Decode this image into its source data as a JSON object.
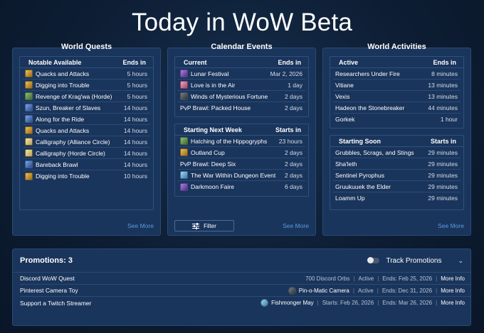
{
  "page_title": "Today in WoW Beta",
  "world_quests": {
    "title": "World Quests",
    "header_name": "Notable Available",
    "header_time": "Ends in",
    "items": [
      {
        "name": "Quacks and Attacks",
        "time": "5 hours",
        "icon": "gold"
      },
      {
        "name": "Digging into Trouble",
        "time": "5 hours",
        "icon": "gold"
      },
      {
        "name": "Revenge of Krag'wa (Horde)",
        "time": "5 hours",
        "icon": "green"
      },
      {
        "name": "Szun, Breaker of Slaves",
        "time": "14 hours",
        "icon": "blue"
      },
      {
        "name": "Along for the Ride",
        "time": "14 hours",
        "icon": "blue"
      },
      {
        "name": "Quacks and Attacks",
        "time": "14 hours",
        "icon": "gold"
      },
      {
        "name": "Calligraphy (Alliance Circle)",
        "time": "14 hours",
        "icon": "parch"
      },
      {
        "name": "Calligraphy (Horde Circle)",
        "time": "14 hours",
        "icon": "parch"
      },
      {
        "name": "Bareback Brawl",
        "time": "14 hours",
        "icon": "blue"
      },
      {
        "name": "Digging into Trouble",
        "time": "10 hours",
        "icon": "gold"
      }
    ],
    "see_more": "See More"
  },
  "calendar": {
    "title": "Calendar Events",
    "current_header": "Current",
    "current_time_header": "Ends in",
    "current": [
      {
        "name": "Lunar Festival",
        "time": "Mar 2, 2026",
        "icon": "purple"
      },
      {
        "name": "Love is in the Air",
        "time": "1 day",
        "icon": "pink"
      },
      {
        "name": "Winds of Mysterious Fortune",
        "time": "2 days",
        "icon": "dark"
      },
      {
        "name": "PvP Brawl: Packed House",
        "time": "2 days",
        "icon": ""
      }
    ],
    "next_header": "Starting Next Week",
    "next_time_header": "Starts in",
    "next": [
      {
        "name": "Hatching of the Hippogryphs",
        "time": "23 hours",
        "icon": "green"
      },
      {
        "name": "Outland Cup",
        "time": "2 days",
        "icon": "gold"
      },
      {
        "name": "PvP Brawl: Deep Six",
        "time": "2 days",
        "icon": ""
      },
      {
        "name": "The War Within Dungeon Event",
        "time": "2 days",
        "icon": "lightblue"
      },
      {
        "name": "Darkmoon Faire",
        "time": "6 days",
        "icon": "purple"
      }
    ],
    "filter_label": "Filter",
    "see_more": "See More"
  },
  "world_activities": {
    "title": "World Activities",
    "active_header": "Active",
    "active_time_header": "Ends in",
    "active": [
      {
        "name": "Researchers Under Fire",
        "time": "8 minutes"
      },
      {
        "name": "Vitiane",
        "time": "13 minutes"
      },
      {
        "name": "Vexis",
        "time": "13 minutes"
      },
      {
        "name": "Hadeon the Stonebreaker",
        "time": "44 minutes"
      },
      {
        "name": "Gorkek",
        "time": "1 hour"
      }
    ],
    "soon_header": "Starting Soon",
    "soon_time_header": "Starts in",
    "soon": [
      {
        "name": "Grubbles, Scrags, and Stings",
        "time": "29 minutes"
      },
      {
        "name": "Sha'leth",
        "time": "29 minutes"
      },
      {
        "name": "Sentinel Pyrophus",
        "time": "29 minutes"
      },
      {
        "name": "Gruukuuek the Elder",
        "time": "29 minutes"
      },
      {
        "name": "Loamm Up",
        "time": "29 minutes"
      }
    ],
    "see_more": "See More"
  },
  "promotions": {
    "title": "Promotions: 3",
    "track_label": "Track Promotions",
    "items": [
      {
        "name": "Discord WoW Quest",
        "reward": "700 Discord Orbs",
        "status": "Active",
        "dates": "Ends: Feb 25, 2026",
        "more": "More Info",
        "reward_icon": ""
      },
      {
        "name": "Pinterest Camera Toy",
        "reward": "Pin-o-Matic Camera",
        "status": "Active",
        "dates": "Ends: Dec 31, 2026",
        "more": "More Info",
        "reward_icon": "dark"
      },
      {
        "name": "Support a Twitch Streamer",
        "reward": "Fishmonger May",
        "status": "Starts: Feb 26, 2026",
        "dates": "Ends: Mar 26, 2026",
        "more": "More Info",
        "reward_icon": "lightblue"
      }
    ]
  }
}
